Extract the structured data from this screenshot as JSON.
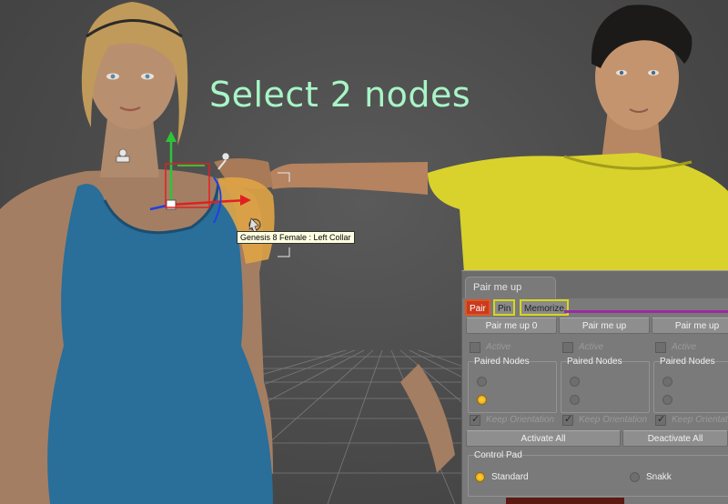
{
  "viewport": {
    "caption": "Select 2 nodes",
    "tooltip": "Genesis 8 Female : Left Collar",
    "colors": {
      "background": "#4a4a4a",
      "caption": "#a8f5c6",
      "grid": "#8a8a8a"
    }
  },
  "pane": {
    "title": "Pair me up",
    "subtabs": [
      {
        "label": "Pair",
        "active": true
      },
      {
        "label": "Pin",
        "active": false
      },
      {
        "label": "Memorize",
        "active": false
      }
    ],
    "pair_buttons": [
      "Pair me up 0",
      "Pair me up",
      "Pair me up"
    ],
    "active_label": "Active",
    "paired_nodes_label": "Paired Nodes",
    "keep_orientation_label": "Keep Orientation",
    "activate_all": "Activate All",
    "deactivate_all": "Deactivate All",
    "control_pad_label": "Control Pad",
    "control_pad_options": [
      {
        "label": "Standard",
        "selected": true
      },
      {
        "label": "Snakk",
        "selected": false
      }
    ],
    "colors": {
      "active_tab": "#c93b1e",
      "tab_outline": "#d7d71a",
      "accent_line": "#9a2aa0",
      "radio_on": "#f0b21a"
    }
  }
}
